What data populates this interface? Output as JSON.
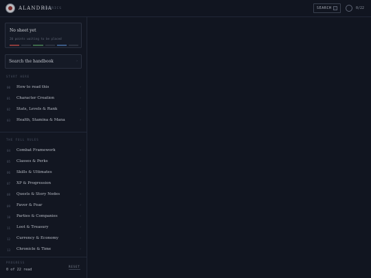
{
  "header": {
    "brand": "ALANDRIA",
    "brand_sub": "RUBRICS",
    "search_label": "SEARCH",
    "search_kbd": "/",
    "counter": "0/22",
    "logo_icon": "seal-icon"
  },
  "sheet": {
    "title": "No sheet yet",
    "subtitle": "20 points waiting to be placed",
    "bar_colors": [
      "#8b3b3b",
      "#3d6a4a",
      "#3b5a85"
    ]
  },
  "handbook_search": {
    "label": "Search the handbook",
    "arrow": "›"
  },
  "sections": {
    "start_here": "START HERE",
    "full_rules": "THE FULL RULES"
  },
  "start_items": [
    {
      "num": "00",
      "label": "How to read this"
    },
    {
      "num": "01",
      "label": "Character Creation"
    },
    {
      "num": "02",
      "label": "Stats, Levels & Rank"
    },
    {
      "num": "03",
      "label": "Health, Stamina & Mana"
    }
  ],
  "rule_items": [
    {
      "num": "04",
      "label": "Combat Framework"
    },
    {
      "num": "05",
      "label": "Classes & Perks"
    },
    {
      "num": "06",
      "label": "Skills & Ultimates"
    },
    {
      "num": "07",
      "label": "XP & Progression"
    },
    {
      "num": "08",
      "label": "Quests & Story Nodes"
    },
    {
      "num": "09",
      "label": "Favor & Fear"
    },
    {
      "num": "10",
      "label": "Parties & Companies"
    },
    {
      "num": "11",
      "label": "Loot & Treasury"
    },
    {
      "num": "12",
      "label": "Currency & Economy"
    },
    {
      "num": "13",
      "label": "Chronicle & Time"
    }
  ],
  "progress": {
    "label": "PROGRESS",
    "value": "0 of 22 read",
    "reset_label": "RESET"
  }
}
